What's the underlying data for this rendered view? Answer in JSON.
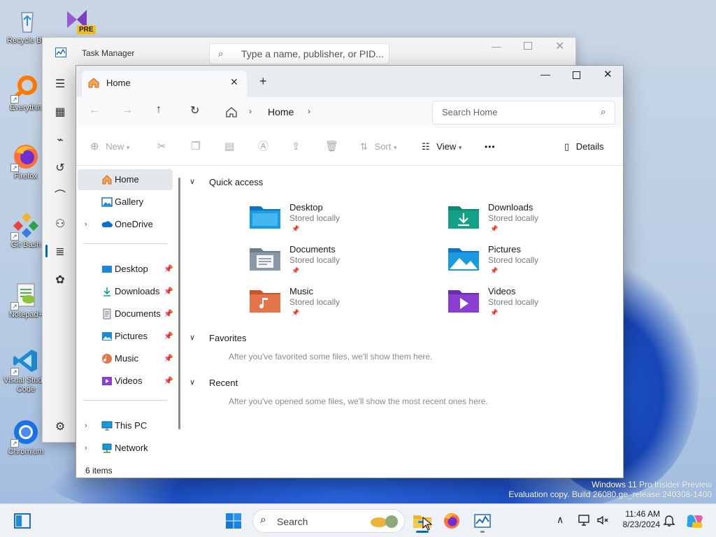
{
  "desktop": {
    "icons": [
      {
        "label": "Recycle Bin",
        "name": "recycle-bin"
      },
      {
        "label": "Everythin",
        "name": "everything"
      },
      {
        "label": "Firefox",
        "name": "firefox"
      },
      {
        "label": "Git Bash",
        "name": "git-bash"
      },
      {
        "label": "Notepad+",
        "name": "notepad-plus"
      },
      {
        "label": "Visual Studio Code",
        "name": "vscode"
      },
      {
        "label": "Chromium",
        "name": "chromium"
      }
    ],
    "vs_badge": "PRE",
    "watermark_line1": "Windows 11 Pro Insider Preview",
    "watermark_line2": "Evaluation copy. Build 26080.ge_release.240308-1400"
  },
  "task_manager": {
    "title": "Task Manager",
    "search_placeholder": "Type a name, publisher, or PID..."
  },
  "explorer": {
    "tab_title": "Home",
    "breadcrumb": "Home",
    "search_placeholder": "Search Home",
    "commands": {
      "new": "New",
      "sort": "Sort",
      "view": "View",
      "more": "•••",
      "details": "Details"
    },
    "sidebar": {
      "top": [
        {
          "label": "Home",
          "selected": true
        },
        {
          "label": "Gallery"
        },
        {
          "label": "OneDrive"
        }
      ],
      "pinned": [
        {
          "label": "Desktop"
        },
        {
          "label": "Downloads"
        },
        {
          "label": "Documents"
        },
        {
          "label": "Pictures"
        },
        {
          "label": "Music"
        },
        {
          "label": "Videos"
        }
      ],
      "bottom": [
        {
          "label": "This PC"
        },
        {
          "label": "Network"
        }
      ]
    },
    "sections": {
      "quick_access": "Quick access",
      "favorites": "Favorites",
      "favorites_empty": "After you've favorited some files, we'll show them here.",
      "recent": "Recent",
      "recent_empty": "After you've opened some files, we'll show the most recent ones here."
    },
    "quick_access_items": [
      {
        "name": "Desktop",
        "status": "Stored locally"
      },
      {
        "name": "Downloads",
        "status": "Stored locally"
      },
      {
        "name": "Documents",
        "status": "Stored locally"
      },
      {
        "name": "Pictures",
        "status": "Stored locally"
      },
      {
        "name": "Music",
        "status": "Stored locally"
      },
      {
        "name": "Videos",
        "status": "Stored locally"
      }
    ],
    "status": "6 items"
  },
  "taskbar": {
    "search_label": "Search",
    "time": "11:46 AM",
    "date": "8/23/2024"
  },
  "colors": {
    "accent": "#0067c0",
    "folder_blue": "#1a8ad4",
    "folder_teal": "#12a187",
    "folder_orange": "#e5744a",
    "folder_purple": "#8a3fd1"
  }
}
